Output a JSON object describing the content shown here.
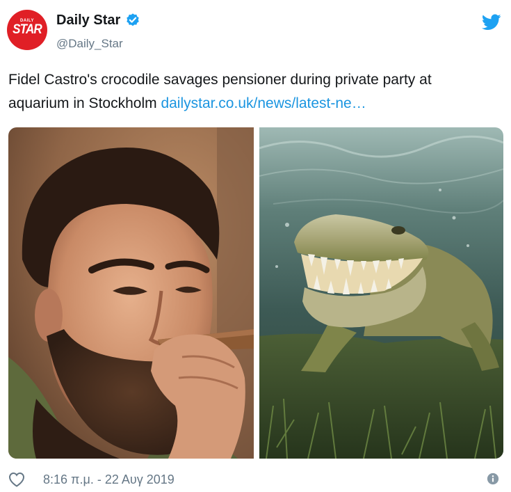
{
  "account": {
    "name": "Daily Star",
    "handle": "@Daily_Star",
    "avatar_small": "DAILY",
    "avatar_large": "STAR",
    "verified": true
  },
  "tweet": {
    "text": "Fidel Castro's crocodile savages pensioner during private party at aquarium in Stockholm ",
    "link": "dailystar.co.uk/news/latest-ne…"
  },
  "media": {
    "images": [
      "bearded-man-with-cigar-photo",
      "crocodile-underwater-photo"
    ]
  },
  "footer": {
    "timestamp": "8:16 π.μ. - 22 Αυγ 2019"
  },
  "icons": {
    "verified": "verified-badge-icon",
    "brand": "twitter-bird-icon",
    "like": "heart-icon",
    "info": "info-icon"
  },
  "colors": {
    "brand_red": "#e01f26",
    "link_blue": "#1b95e0",
    "twitter_blue": "#1da1f2",
    "secondary_text": "#657786"
  }
}
